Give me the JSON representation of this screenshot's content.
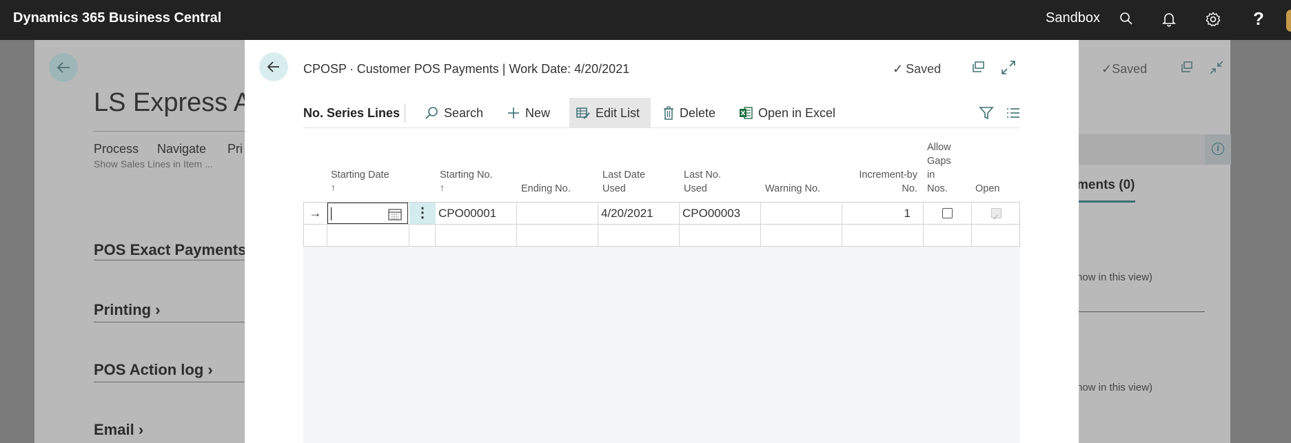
{
  "topbar": {
    "app_title": "Dynamics 365 Business Central",
    "environment": "Sandbox",
    "help_label": "?"
  },
  "background_page": {
    "title": "LS Express Adm",
    "menu": [
      "Process",
      "Navigate",
      "Pri"
    ],
    "sub_text": "Show Sales Lines in Item ...",
    "sections": [
      "POS Exact Payments",
      "Printing",
      "POS Action log",
      "Email"
    ],
    "saved_label": "Saved",
    "tab_label": "ments (0)",
    "empty_texts": [
      "now in this view)",
      "now in this view)"
    ]
  },
  "modal": {
    "caption": "CPOSP ∙ Customer POS Payments | Work Date: 4/20/2021",
    "saved_label": "Saved",
    "part_title": "No. Series Lines",
    "actions": {
      "search": "Search",
      "new": "New",
      "edit_list": "Edit List",
      "delete": "Delete",
      "open_in_excel": "Open in Excel"
    },
    "columns": {
      "starting_date": "Starting Date",
      "starting_no": "Starting No.",
      "ending_no": "Ending No.",
      "last_date_used": [
        "Last Date",
        "Used"
      ],
      "last_no_used": [
        "Last No.",
        "Used"
      ],
      "warning_no": "Warning No.",
      "increment_by_no": [
        "Increment-by",
        "No."
      ],
      "allow_gaps": [
        "Allow",
        "Gaps",
        "in",
        "Nos."
      ],
      "open": "Open",
      "sort_arrow": "↑"
    },
    "rows": [
      {
        "marker": "→",
        "starting_date": "",
        "starting_no": "CPO00001",
        "ending_no": "",
        "last_date_used": "4/20/2021",
        "last_no_used": "CPO00003",
        "warning_no": "",
        "increment_by_no": "1",
        "allow_gaps": false,
        "open": true
      }
    ]
  },
  "colors": {
    "topbar": "#222222",
    "accent": "#3b6e74",
    "selected_cell": "#d5ecee",
    "back_button": "#daedee"
  }
}
